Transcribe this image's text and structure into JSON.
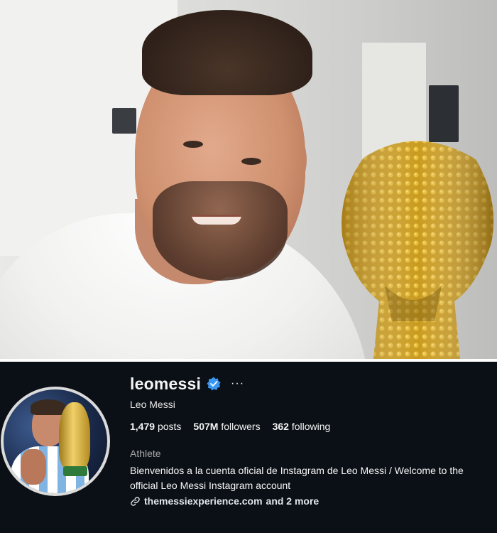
{
  "photo": {
    "alt_subject": "man-with-lego-trophy"
  },
  "profile": {
    "username": "leomessi",
    "verified": true,
    "full_name": "Leo Messi",
    "stats": {
      "posts_value": "1,479",
      "posts_label": "posts",
      "followers_value": "507M",
      "followers_label": "followers",
      "following_value": "362",
      "following_label": "following"
    },
    "category": "Athlete",
    "bio": "Bienvenidos a la cuenta oficial de Instagram de Leo Messi / Welcome to the official Leo Messi Instagram account",
    "link": {
      "url_text": "themessiexperience.com",
      "more_text": "and 2 more"
    },
    "more_options_glyph": "···"
  },
  "colors": {
    "background": "#0b1016",
    "verified_badge": "#3897f0",
    "text_primary": "#f5f5f5",
    "text_secondary": "#a8a8a8"
  }
}
